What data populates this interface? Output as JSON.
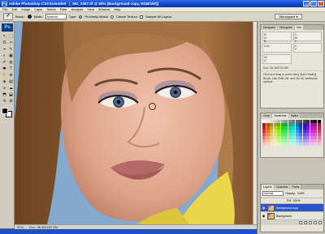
{
  "window": {
    "title": "Adobe Photoshop CS3 Extended - [_MG_0367.tif @ 50% (Background copy, RGB/16#)]",
    "min_glyph": "_",
    "max_glyph": "□",
    "close_glyph": "×"
  },
  "menu": [
    "File",
    "Edit",
    "Image",
    "Layer",
    "Select",
    "Filter",
    "Analysis",
    "View",
    "Window",
    "Help"
  ],
  "options": {
    "brush_label": "Brush:",
    "mode_label": "Mode:",
    "mode_value": "Normal",
    "type_label": "Type:",
    "type_option_1": "Proximity Match",
    "type_option_2": "Create Texture",
    "sample_all_layers": "Sample All Layers",
    "workspace": "Workspace ▾"
  },
  "toolbox": {
    "badge": "Ps",
    "tools": [
      "↖",
      "⬚",
      "ʘ",
      "✂",
      "⌖",
      "✎",
      "◐",
      "▣",
      "✐",
      "◍",
      "⬬",
      "T",
      "✋",
      "⊕",
      "◈",
      "▤",
      "⌀",
      "☁",
      "⬒",
      "⬓",
      "⟲",
      "⊞"
    ]
  },
  "status": {
    "zoom": "50%",
    "doc": "Doc: 96.4M/192.9M"
  },
  "panels": {
    "navigator_tabs": [
      "Navigator",
      "Histogram",
      "Info"
    ],
    "info": [
      {
        "l1": "R:",
        "l2": "G:",
        "l3": "B:"
      },
      {
        "l1": "C:",
        "l2": "M:",
        "l3": "Y:"
      },
      {
        "l1": "8-bit",
        "l2": "",
        "l3": ""
      },
      {
        "l1": "X:",
        "l2": "Y:",
        "l3": ""
      },
      {
        "l1": "W:",
        "l2": "H:",
        "l3": ""
      }
    ],
    "doc_info": "Doc: 96.4M/192.9M",
    "hint": "Click and drag to paint using Spot Healing Brush. Use Shift, Alt, and Ctrl for additional options.",
    "swatch_tabs": [
      "Color",
      "Swatches",
      "Styles"
    ],
    "layers_tabs": [
      "Layers",
      "Channels",
      "Paths"
    ],
    "blend_mode": "Normal",
    "opacity_label": "Opacity:",
    "opacity_value": "100%",
    "fill_label": "Fill:",
    "fill_value": "100%",
    "layers": [
      {
        "name": "Background copy",
        "selected": true
      },
      {
        "name": "Background",
        "selected": false
      }
    ],
    "eye_glyph": "◉"
  },
  "colors": {
    "foreground": "#000000",
    "background": "#ffffff",
    "layer_selected": "#2a55c9",
    "title_bar": "#1148c8"
  }
}
